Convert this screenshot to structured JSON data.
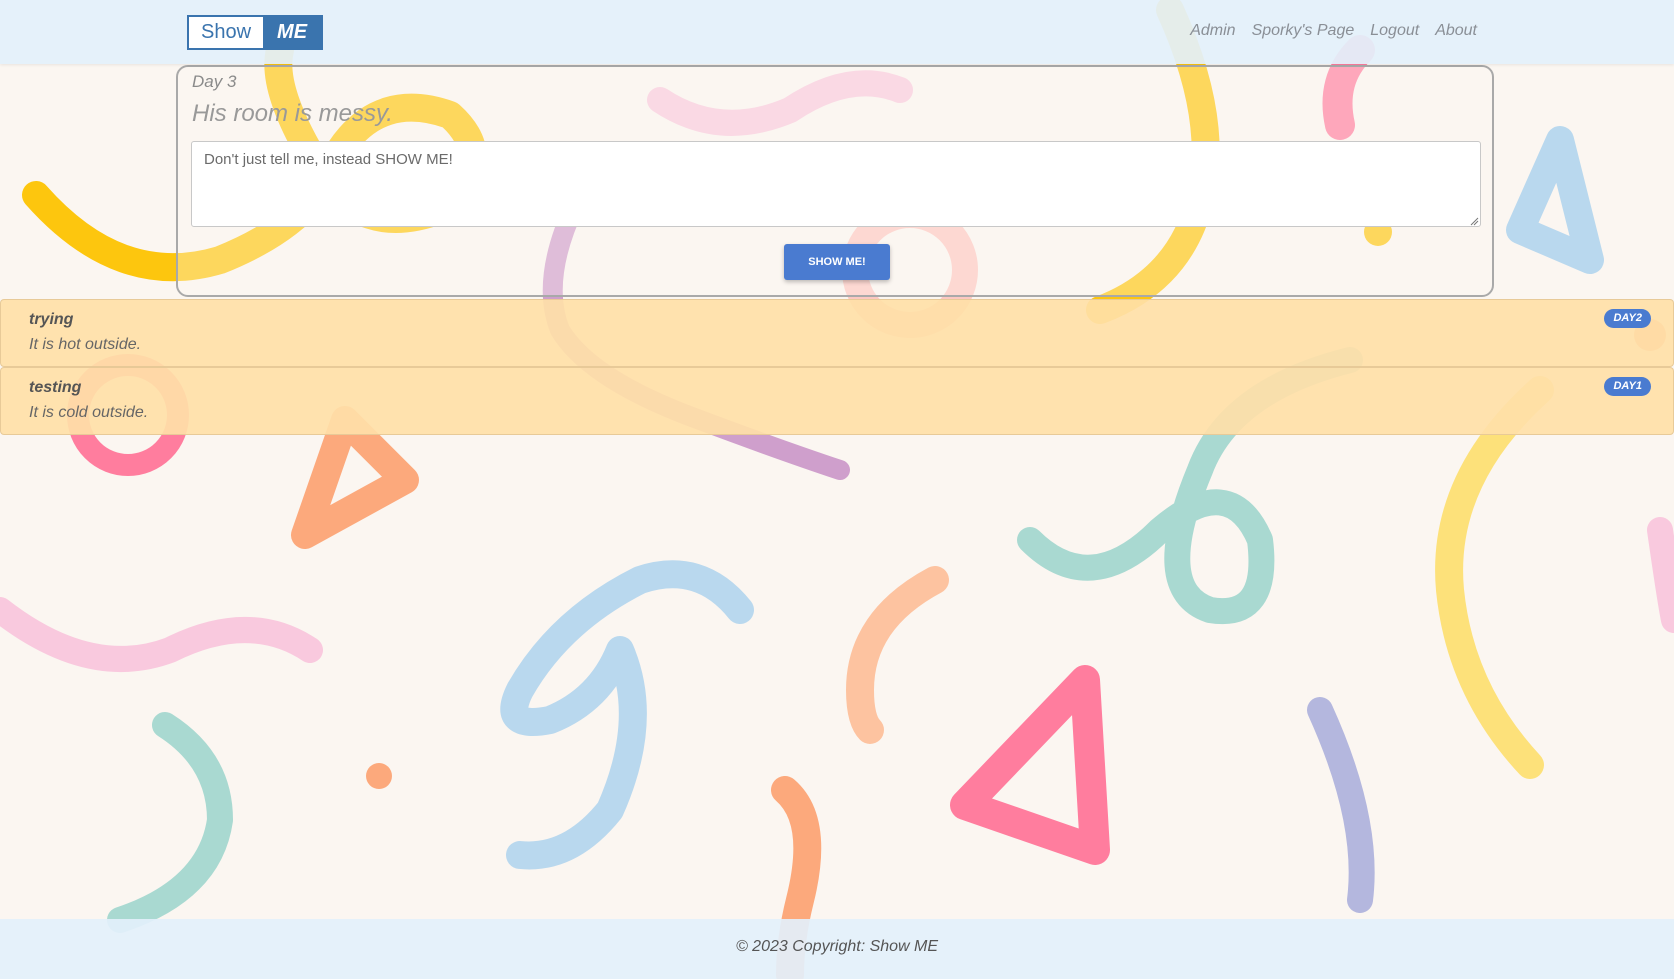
{
  "brand": {
    "show": "Show",
    "me": "ME"
  },
  "nav": {
    "links": [
      "Admin",
      "Sporky's Page",
      "Logout",
      "About"
    ]
  },
  "prompt": {
    "day": "Day 3",
    "text": "His room is messy.",
    "entry_placeholder": "Don't just tell me, instead SHOW ME!",
    "button_label": "SHOW ME!"
  },
  "entries": [
    {
      "title": "trying",
      "text": "It is hot outside.",
      "badge": "DAY2"
    },
    {
      "title": "testing",
      "text": "It is cold outside.",
      "badge": "DAY1"
    }
  ],
  "footer": {
    "text": "© 2023 Copyright: Show ME"
  },
  "colors": {
    "navbar": "#e3f0fb",
    "brand_blue": "#3a74ae",
    "button_blue": "#4a7bd0",
    "entry_bg": "#ffe0a8",
    "page_bg": "#fbf6f1"
  }
}
